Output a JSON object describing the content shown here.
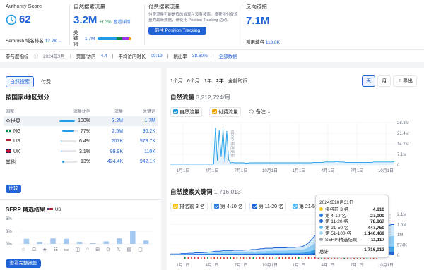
{
  "kpis": {
    "authority": {
      "label": "Authority Score",
      "value": "62",
      "rank_label": "Semrush 域名排名",
      "rank_value": "12.2K"
    },
    "organic": {
      "label": "自然搜索流量",
      "value": "3.2M",
      "change": "+1.3%",
      "link": "查看详情",
      "kw_label": "关键词",
      "kw_value": "1.7M"
    },
    "paid": {
      "label": "付费搜索流量",
      "description": "付费流量可能是假的或现在没有搜索。要获得付费流量的最新数据，请使用 Position Tracking 活动。",
      "button": "前往 Position Tracking"
    },
    "backlinks": {
      "label": "反向链接",
      "value": "7.1M",
      "ref_label": "引用域名",
      "ref_value": "118.8K"
    }
  },
  "stats_bar": {
    "benchmark": "参与度指标",
    "date": "2024年9月",
    "visits_label": "页面/访问",
    "visits_value": "4.4",
    "time_label": "平均访问时长",
    "time_value": "09:19",
    "bounce_label": "跳出率",
    "bounce_value": "38.60%",
    "all_data": "全部数据"
  },
  "left": {
    "tabs": [
      "自然搜索",
      "付费"
    ],
    "section_title": "按国家/地区划分",
    "columns": [
      "国家",
      "流量比例",
      "流量",
      "关键词"
    ],
    "rows": [
      {
        "country": "全世界",
        "share": "100%",
        "share_num": 100,
        "traffic": "3.2M",
        "keywords": "1.7M",
        "flag": "globe"
      },
      {
        "country": "NG",
        "share": "77%",
        "share_num": 77,
        "traffic": "2.5M",
        "keywords": "90.2K",
        "flag": "ng"
      },
      {
        "country": "US",
        "share": "6.4%",
        "share_num": 6.4,
        "traffic": "207K",
        "keywords": "573.7K",
        "flag": "us"
      },
      {
        "country": "UK",
        "share": "3.1%",
        "share_num": 3.1,
        "traffic": "99.9K",
        "keywords": "110K",
        "flag": "uk"
      },
      {
        "country": "其他",
        "share": "13%",
        "share_num": 13,
        "traffic": "424.4K",
        "keywords": "942.1K",
        "flag": "none"
      }
    ],
    "compare_button": "比较",
    "serp_title": "SERP 精选结果",
    "serp_country": "US",
    "serp_ticks": [
      "6%",
      "3%",
      "0%"
    ],
    "serp_bars": [
      1.2,
      0.5,
      1.3,
      1.2,
      0.5,
      0.2,
      0.6,
      1.3,
      3.0,
      0.8
    ],
    "view_report": "查看完整报告"
  },
  "right": {
    "periods": [
      "1个月",
      "6个月",
      "1年",
      "2年",
      "全部时间"
    ],
    "active_period": "2年",
    "granularity": [
      "天",
      "月"
    ],
    "active_granularity": "天",
    "export": "导出",
    "traffic_title": "自然流量",
    "traffic_value": "3,212,724/月",
    "traffic_legend": [
      {
        "label": "自然流量",
        "color": "#1f9de8"
      },
      {
        "label": "付费流量",
        "color": "#f59e0b"
      }
    ],
    "notes": "备注",
    "serp_update": "SERP 精选更新",
    "x_ticks": [
      "1月1日",
      "4月1日",
      "7月1日",
      "10月1日",
      "1月1日",
      "4月1日",
      "7月1日",
      "10月1日"
    ],
    "traffic_y_ticks": [
      "28.3M",
      "21.4M",
      "14.2M",
      "7.1M",
      "0"
    ],
    "kw_title": "自然搜索关键词",
    "kw_value": "1,716,013",
    "kw_legend": [
      {
        "label": "排名前 3 名",
        "color": "#f5c518"
      },
      {
        "label": "第 4-10 名",
        "color": "#2c7be5"
      },
      {
        "label": "第 11-20 名",
        "color": "#1f63d6"
      },
      {
        "label": "第 21-50 名",
        "color": "#5bb8f0"
      }
    ],
    "kw_y_ticks": [
      "2.1M",
      "1.5M",
      "1M",
      "574K",
      "0"
    ],
    "tooltip": {
      "date": "2024年10月31日",
      "rows": [
        {
          "label": "排名前 3 名",
          "value": "4,810",
          "color": "#f5c518"
        },
        {
          "label": "第 4-10 名",
          "value": "27,000",
          "color": "#2c7be5"
        },
        {
          "label": "第 11-20 名",
          "value": "78,867",
          "color": "#1f63d6"
        },
        {
          "label": "第 21-50 名",
          "value": "447,750",
          "color": "#5bb8f0"
        },
        {
          "label": "第 51-100 名",
          "value": "1,146,469",
          "color": "#a5d8f7"
        },
        {
          "label": "SERP 精选结果",
          "value": "11,117",
          "color": "#9ca3af"
        }
      ],
      "total_label": "总计",
      "total_value": "1,716,013"
    },
    "traffic_series": [
      0.02,
      0.02,
      0.02,
      0.02,
      0.02,
      0.02,
      0.02,
      0.02,
      0.02,
      0.02,
      0.02,
      0.02,
      0.02,
      0.02,
      0.02,
      0.02,
      0.02,
      0.02,
      0.02,
      0.02,
      0.02,
      0.02,
      0.02,
      0.02,
      0.88,
      0.1,
      0.82,
      0.2,
      0.85,
      0.06,
      0.8,
      0.12,
      0.05,
      0.06,
      0.05,
      0.05,
      0.05,
      0.05,
      0.05,
      0.05,
      0.04,
      0.04,
      0.05,
      0.05,
      0.05,
      0.05,
      0.05,
      0.05,
      0.05,
      0.05,
      0.05,
      0.05,
      0.05,
      0.05,
      0.05,
      0.05,
      0.05,
      0.05,
      0.05,
      0.05,
      0.05,
      0.05,
      0.05,
      0.05,
      0.05,
      0.05,
      0.05,
      0.05,
      0.05,
      0.05,
      0.05,
      0.05,
      0.05,
      0.05,
      0.05,
      0.05,
      0.06,
      0.06,
      0.06,
      0.06,
      0.06,
      0.06,
      0.07,
      0.07,
      0.07,
      0.07,
      0.07,
      0.07,
      0.08,
      0.08,
      0.07,
      0.07,
      0.07,
      0.06,
      0.06,
      0.06,
      0.06,
      0.06,
      0.06,
      0.06,
      0.06,
      0.06,
      0.06,
      0.06,
      0.06,
      0.06,
      0.06,
      0.06,
      0.07,
      0.07,
      0.07,
      0.07,
      0.07,
      0.07,
      0.07,
      0.07,
      0.07,
      0.07,
      0.07,
      0.08
    ],
    "kw_series": [
      0.03,
      0.03,
      0.03,
      0.03,
      0.03,
      0.04,
      0.04,
      0.04,
      0.05,
      0.05,
      0.05,
      0.06,
      0.06,
      0.06,
      0.06,
      0.07,
      0.07,
      0.08,
      0.08,
      0.09,
      0.1,
      0.1,
      0.1,
      0.11,
      0.11,
      0.11,
      0.11,
      0.11,
      0.12,
      0.12,
      0.12,
      0.12,
      0.12,
      0.13,
      0.13,
      0.13,
      0.14,
      0.14,
      0.14,
      0.15,
      0.16,
      0.16,
      0.17,
      0.17,
      0.17,
      0.17,
      0.18,
      0.18,
      0.18,
      0.18,
      0.18,
      0.18,
      0.19,
      0.19,
      0.19,
      0.19,
      0.2,
      0.2,
      0.21,
      0.23,
      0.26,
      0.3,
      0.36,
      0.42,
      0.48,
      0.52,
      0.54,
      0.55,
      0.56,
      0.56,
      0.56,
      0.56,
      0.56,
      0.56,
      0.56,
      0.55,
      0.55,
      0.55,
      0.55,
      0.55,
      0.55,
      0.56,
      0.56,
      0.57,
      0.58,
      0.59,
      0.6,
      0.62,
      0.65,
      0.66,
      0.67,
      0.68,
      0.69,
      0.7,
      0.71,
      0.72,
      0.73,
      0.74,
      0.75,
      0.75
    ]
  }
}
